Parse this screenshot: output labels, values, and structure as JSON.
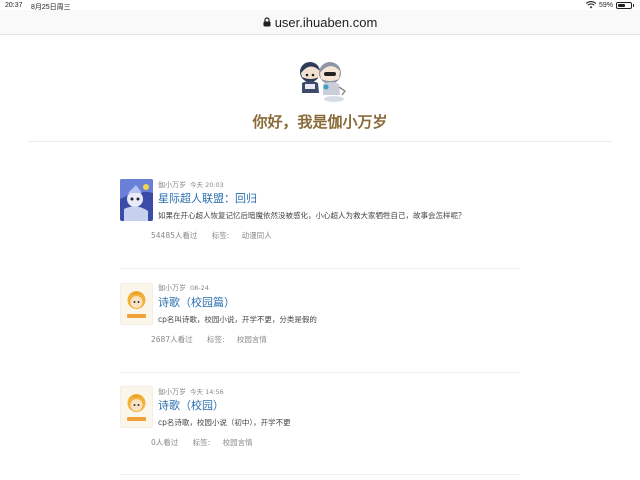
{
  "status_bar": {
    "time": "20:37",
    "date": "8月25日周三",
    "battery": "59%",
    "battery_level": 0.59
  },
  "browser": {
    "url": "user.ihuaben.com"
  },
  "profile": {
    "greeting": "你好，我是伽小万岁"
  },
  "posts": [
    {
      "author": "伽小万岁",
      "date": "今天 20:03",
      "title": "星际超人联盟：回归",
      "summary": "如果在开心超人恢复记忆后暗魔依然没被感化，小心超人为救大家牺牲自己，故事会怎样呢？",
      "views": "54485人看过",
      "tag_label": "标签:",
      "tag": "动漫同人"
    },
    {
      "author": "伽小万岁",
      "date": "08-24",
      "title": "诗歌（校园篇）",
      "summary": "cp名叫诗歌，校园小说，开学不更，分类是假的",
      "views": "2687人看过",
      "tag_label": "标签:",
      "tag": "校园言情"
    },
    {
      "author": "伽小万岁",
      "date": "今天 14:56",
      "title": "诗歌（校园）",
      "summary": "cp名诗歌，校园小说（初中），开学不更",
      "views": "0人看过",
      "tag_label": "标签:",
      "tag": "校园言情"
    }
  ],
  "colors": {
    "title_blue": "#2a6fb0",
    "greeting_brown": "#8a6a38"
  }
}
